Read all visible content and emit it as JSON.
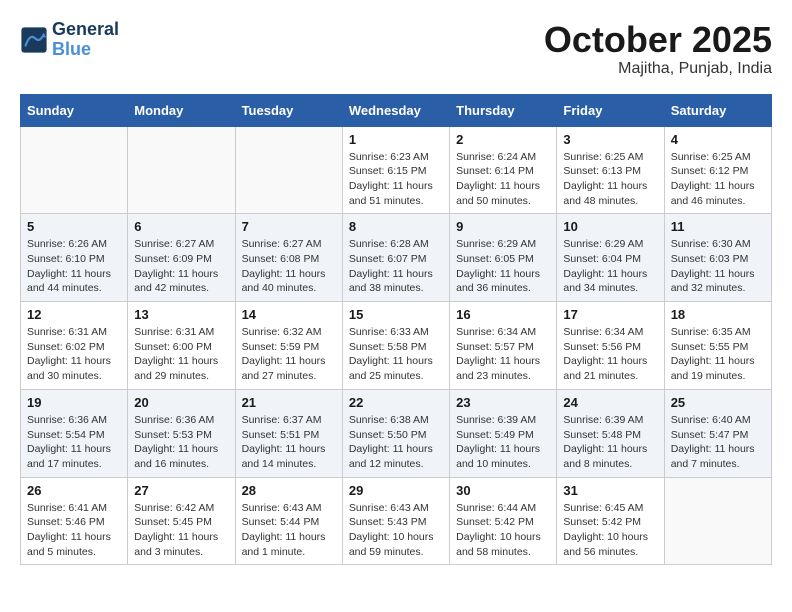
{
  "header": {
    "logo_line1": "General",
    "logo_line2": "Blue",
    "month_title": "October 2025",
    "location": "Majitha, Punjab, India"
  },
  "weekdays": [
    "Sunday",
    "Monday",
    "Tuesday",
    "Wednesday",
    "Thursday",
    "Friday",
    "Saturday"
  ],
  "weeks": [
    [
      {
        "day": "",
        "info": ""
      },
      {
        "day": "",
        "info": ""
      },
      {
        "day": "",
        "info": ""
      },
      {
        "day": "1",
        "info": "Sunrise: 6:23 AM\nSunset: 6:15 PM\nDaylight: 11 hours\nand 51 minutes."
      },
      {
        "day": "2",
        "info": "Sunrise: 6:24 AM\nSunset: 6:14 PM\nDaylight: 11 hours\nand 50 minutes."
      },
      {
        "day": "3",
        "info": "Sunrise: 6:25 AM\nSunset: 6:13 PM\nDaylight: 11 hours\nand 48 minutes."
      },
      {
        "day": "4",
        "info": "Sunrise: 6:25 AM\nSunset: 6:12 PM\nDaylight: 11 hours\nand 46 minutes."
      }
    ],
    [
      {
        "day": "5",
        "info": "Sunrise: 6:26 AM\nSunset: 6:10 PM\nDaylight: 11 hours\nand 44 minutes."
      },
      {
        "day": "6",
        "info": "Sunrise: 6:27 AM\nSunset: 6:09 PM\nDaylight: 11 hours\nand 42 minutes."
      },
      {
        "day": "7",
        "info": "Sunrise: 6:27 AM\nSunset: 6:08 PM\nDaylight: 11 hours\nand 40 minutes."
      },
      {
        "day": "8",
        "info": "Sunrise: 6:28 AM\nSunset: 6:07 PM\nDaylight: 11 hours\nand 38 minutes."
      },
      {
        "day": "9",
        "info": "Sunrise: 6:29 AM\nSunset: 6:05 PM\nDaylight: 11 hours\nand 36 minutes."
      },
      {
        "day": "10",
        "info": "Sunrise: 6:29 AM\nSunset: 6:04 PM\nDaylight: 11 hours\nand 34 minutes."
      },
      {
        "day": "11",
        "info": "Sunrise: 6:30 AM\nSunset: 6:03 PM\nDaylight: 11 hours\nand 32 minutes."
      }
    ],
    [
      {
        "day": "12",
        "info": "Sunrise: 6:31 AM\nSunset: 6:02 PM\nDaylight: 11 hours\nand 30 minutes."
      },
      {
        "day": "13",
        "info": "Sunrise: 6:31 AM\nSunset: 6:00 PM\nDaylight: 11 hours\nand 29 minutes."
      },
      {
        "day": "14",
        "info": "Sunrise: 6:32 AM\nSunset: 5:59 PM\nDaylight: 11 hours\nand 27 minutes."
      },
      {
        "day": "15",
        "info": "Sunrise: 6:33 AM\nSunset: 5:58 PM\nDaylight: 11 hours\nand 25 minutes."
      },
      {
        "day": "16",
        "info": "Sunrise: 6:34 AM\nSunset: 5:57 PM\nDaylight: 11 hours\nand 23 minutes."
      },
      {
        "day": "17",
        "info": "Sunrise: 6:34 AM\nSunset: 5:56 PM\nDaylight: 11 hours\nand 21 minutes."
      },
      {
        "day": "18",
        "info": "Sunrise: 6:35 AM\nSunset: 5:55 PM\nDaylight: 11 hours\nand 19 minutes."
      }
    ],
    [
      {
        "day": "19",
        "info": "Sunrise: 6:36 AM\nSunset: 5:54 PM\nDaylight: 11 hours\nand 17 minutes."
      },
      {
        "day": "20",
        "info": "Sunrise: 6:36 AM\nSunset: 5:53 PM\nDaylight: 11 hours\nand 16 minutes."
      },
      {
        "day": "21",
        "info": "Sunrise: 6:37 AM\nSunset: 5:51 PM\nDaylight: 11 hours\nand 14 minutes."
      },
      {
        "day": "22",
        "info": "Sunrise: 6:38 AM\nSunset: 5:50 PM\nDaylight: 11 hours\nand 12 minutes."
      },
      {
        "day": "23",
        "info": "Sunrise: 6:39 AM\nSunset: 5:49 PM\nDaylight: 11 hours\nand 10 minutes."
      },
      {
        "day": "24",
        "info": "Sunrise: 6:39 AM\nSunset: 5:48 PM\nDaylight: 11 hours\nand 8 minutes."
      },
      {
        "day": "25",
        "info": "Sunrise: 6:40 AM\nSunset: 5:47 PM\nDaylight: 11 hours\nand 7 minutes."
      }
    ],
    [
      {
        "day": "26",
        "info": "Sunrise: 6:41 AM\nSunset: 5:46 PM\nDaylight: 11 hours\nand 5 minutes."
      },
      {
        "day": "27",
        "info": "Sunrise: 6:42 AM\nSunset: 5:45 PM\nDaylight: 11 hours\nand 3 minutes."
      },
      {
        "day": "28",
        "info": "Sunrise: 6:43 AM\nSunset: 5:44 PM\nDaylight: 11 hours\nand 1 minute."
      },
      {
        "day": "29",
        "info": "Sunrise: 6:43 AM\nSunset: 5:43 PM\nDaylight: 10 hours\nand 59 minutes."
      },
      {
        "day": "30",
        "info": "Sunrise: 6:44 AM\nSunset: 5:42 PM\nDaylight: 10 hours\nand 58 minutes."
      },
      {
        "day": "31",
        "info": "Sunrise: 6:45 AM\nSunset: 5:42 PM\nDaylight: 10 hours\nand 56 minutes."
      },
      {
        "day": "",
        "info": ""
      }
    ]
  ]
}
